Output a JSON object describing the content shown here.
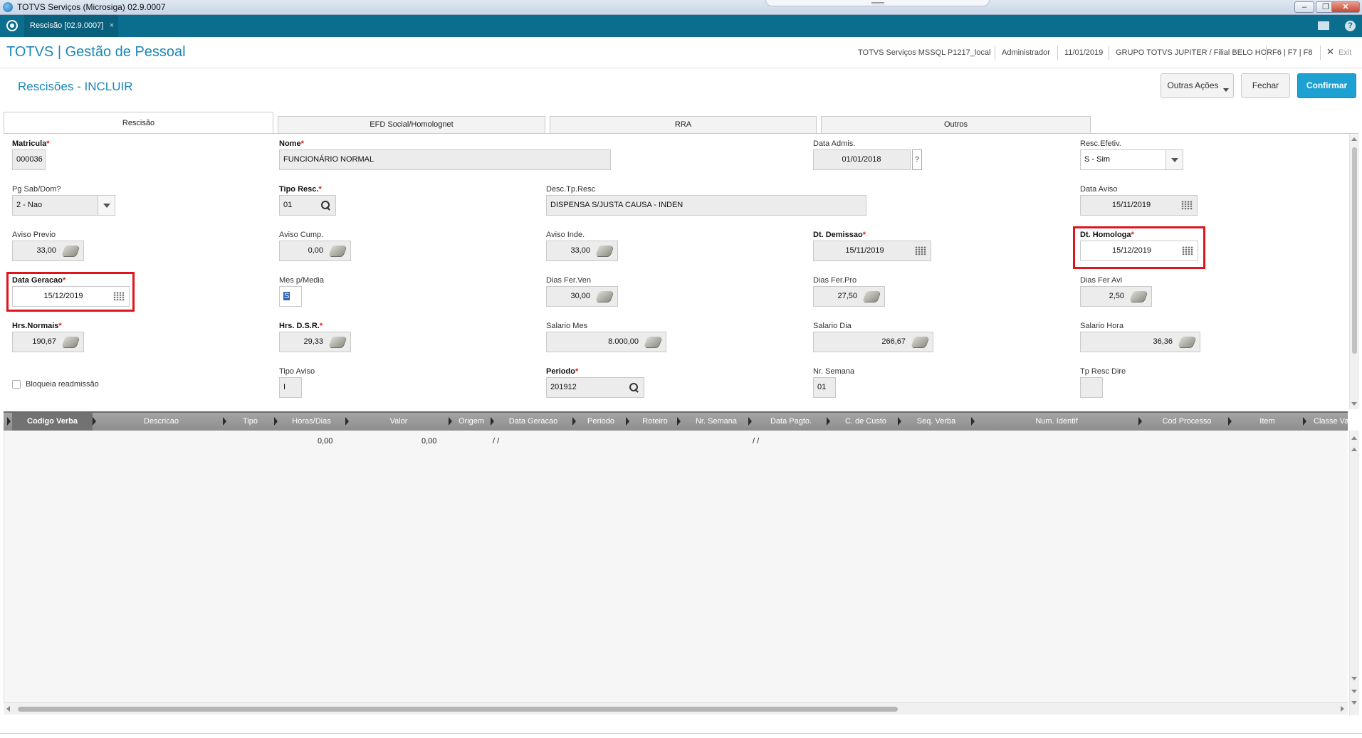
{
  "window": {
    "title": "TOTVS Serviços (Microsiga) 02.9.0007"
  },
  "tabbar": {
    "tab_label": "Rescisão [02.9.0007]",
    "tab_close": "×",
    "help": "?"
  },
  "module": {
    "brand": "TOTVS | Gestão de Pessoal",
    "env": "TOTVS Serviços MSSQL P1217_local",
    "user": "Administrador",
    "date": "11/01/2019",
    "branch": "GRUPO TOTVS JUPITER / Filial BELO HOR",
    "shortcuts": "F6 | F7 | F8",
    "exit": "Exit"
  },
  "page": {
    "title": "Rescisões - INCLUIR",
    "other_actions": "Outras Ações",
    "close": "Fechar",
    "confirm": "Confirmar"
  },
  "folders": [
    "Rescisão",
    "EFD Social/Homolognet",
    "RRA",
    "Outros"
  ],
  "form": {
    "matricula": {
      "label": "Matricula",
      "value": "000036"
    },
    "nome": {
      "label": "Nome",
      "value": "FUNCIONÁRIO NORMAL"
    },
    "data_admis": {
      "label": "Data Admis.",
      "value": "01/01/2018"
    },
    "resc_efetiv": {
      "label": "Resc.Efetiv.",
      "value": "S - Sim"
    },
    "pg_sab_dom": {
      "label": "Pg Sab/Dom?",
      "value": "2 - Nao"
    },
    "tipo_resc": {
      "label": "Tipo Resc.",
      "value": "01"
    },
    "desc_tp_resc": {
      "label": "Desc.Tp.Resc",
      "value": "DISPENSA S/JUSTA CAUSA - INDEN"
    },
    "data_aviso": {
      "label": "Data Aviso",
      "value": "15/11/2019"
    },
    "aviso_previo": {
      "label": "Aviso Previo",
      "value": "33,00"
    },
    "aviso_cump": {
      "label": "Aviso Cump.",
      "value": "0,00"
    },
    "aviso_inde": {
      "label": "Aviso Inde.",
      "value": "33,00"
    },
    "dt_demissao": {
      "label": "Dt. Demissao",
      "value": "15/11/2019"
    },
    "dt_homologa": {
      "label": "Dt. Homologa",
      "value": "15/12/2019"
    },
    "data_geracao": {
      "label": "Data Geracao",
      "value": "15/12/2019"
    },
    "mes_p_media": {
      "label": "Mes p/Media",
      "value": "S"
    },
    "dias_fer_ven": {
      "label": "Dias Fer.Ven",
      "value": "30,00"
    },
    "dias_fer_pro": {
      "label": "Dias Fer.Pro",
      "value": "27,50"
    },
    "dias_fer_avi": {
      "label": "Dias Fer Avi",
      "value": "2,50"
    },
    "hrs_normais": {
      "label": "Hrs.Normais",
      "value": "190,67"
    },
    "hrs_dsr": {
      "label": "Hrs. D.S.R.",
      "value": "29,33"
    },
    "salario_mes": {
      "label": "Salario Mes",
      "value": "8.000,00"
    },
    "salario_dia": {
      "label": "Salario Dia",
      "value": "266,67"
    },
    "salario_hora": {
      "label": "Salario Hora",
      "value": "36,36"
    },
    "bloqueia_readmissao": {
      "label": "Bloqueia readmissão",
      "checked": false
    },
    "tipo_aviso": {
      "label": "Tipo Aviso",
      "value": "I"
    },
    "periodo": {
      "label": "Periodo",
      "value": "201912"
    },
    "nr_semana": {
      "label": "Nr. Semana",
      "value": "01"
    },
    "tp_resc_dire": {
      "label": "Tp Resc Dire",
      "value": ""
    },
    "required_mark": "*",
    "help_mark": "?"
  },
  "grid": {
    "columns": [
      "Codigo Verba",
      "Descricao",
      "Tipo",
      "Horas/Dias",
      "Valor",
      "Origem",
      "Data Geracao",
      "Periodo",
      "Roteiro",
      "Nr. Semana",
      "Data Pagto.",
      "C. de Custo",
      "Seq. Verba",
      "Num. Identif",
      "Cod Processo",
      "Item",
      "Classe Val"
    ],
    "rows": [
      {
        "horas_dias": "0,00",
        "valor": "0,00",
        "data_geracao": "/ /",
        "data_pagto": "/ /"
      }
    ]
  },
  "colors": {
    "teal": "#0b6e8e",
    "accent": "#1b88b5",
    "primary_button": "#1da1d3",
    "required": "#e0181b",
    "highlight_box": "#e0141e"
  }
}
